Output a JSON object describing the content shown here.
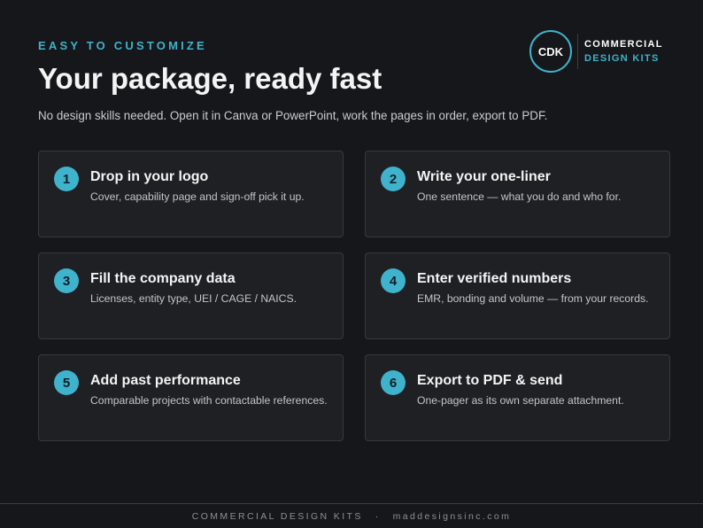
{
  "header": {
    "eyebrow": "EASY TO CUSTOMIZE",
    "title": "Your package, ready fast",
    "subtitle": "No design skills needed. Open it in Canva or PowerPoint, work the pages in order, export to PDF."
  },
  "brand": {
    "monogram": "CDK",
    "line1": "COMMERCIAL",
    "line2": "DESIGN KITS"
  },
  "steps": [
    {
      "number": "1",
      "title": "Drop in your logo",
      "description": "Cover, capability page and sign-off pick it up."
    },
    {
      "number": "2",
      "title": "Write your one-liner",
      "description": "One sentence — what you do and who for."
    },
    {
      "number": "3",
      "title": "Fill the company data",
      "description": "Licenses, entity type, UEI / CAGE / NAICS."
    },
    {
      "number": "4",
      "title": "Enter verified numbers",
      "description": "EMR, bonding and volume — from your records."
    },
    {
      "number": "5",
      "title": "Add past performance",
      "description": "Comparable projects with contactable references."
    },
    {
      "number": "6",
      "title": "Export to PDF & send",
      "description": "One-pager as its own separate attachment."
    }
  ],
  "footer": {
    "left": "COMMERCIAL DESIGN KITS",
    "separator": "·",
    "right": "maddesignsinc.com"
  },
  "colors": {
    "background": "#16171a",
    "accent": "#3fb2cc",
    "card": "#1f2024"
  }
}
